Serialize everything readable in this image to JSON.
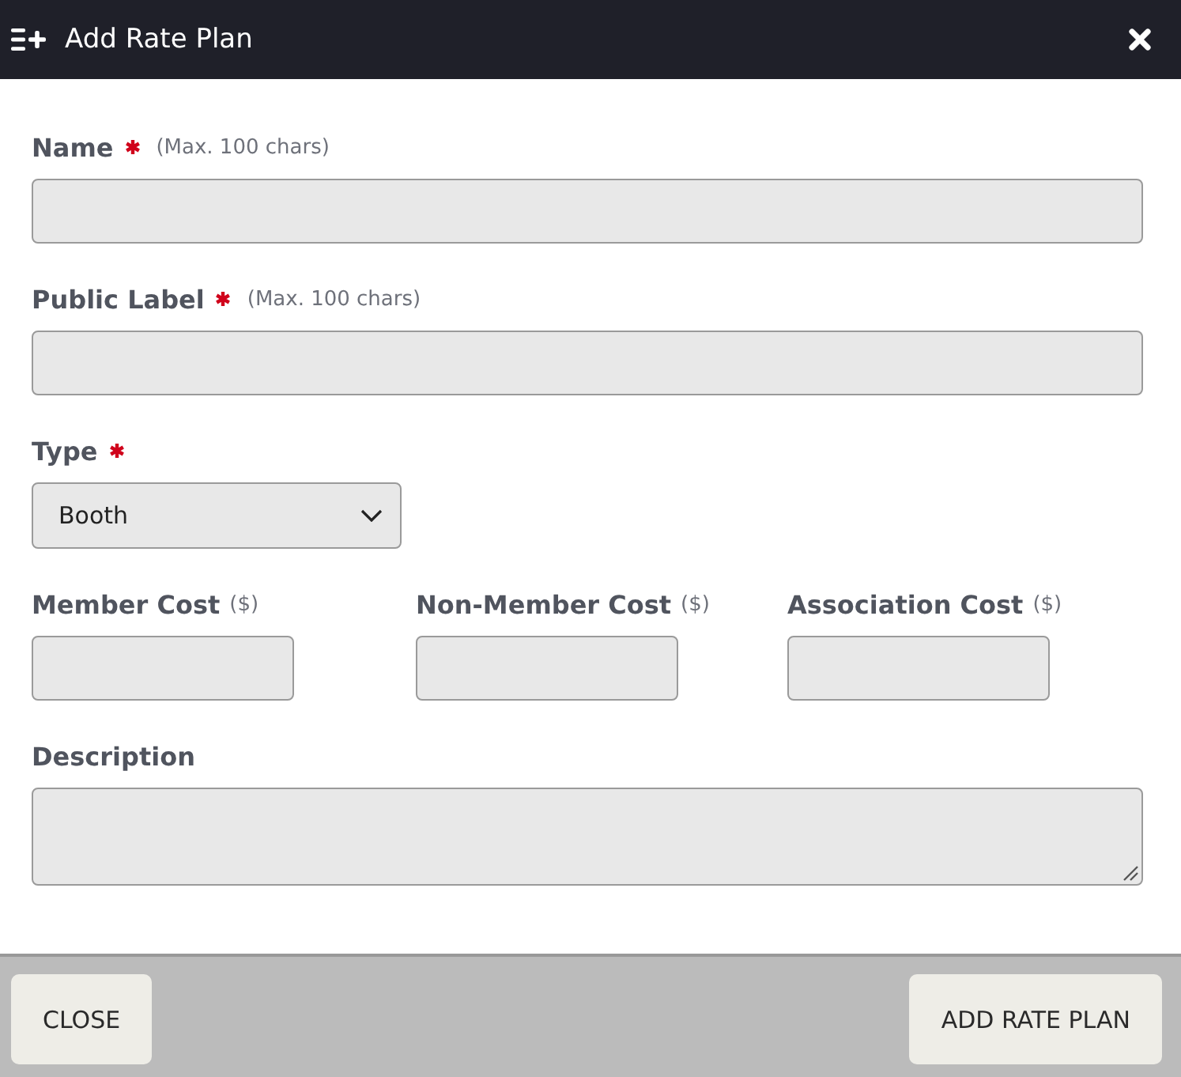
{
  "dialog": {
    "title": "Add Rate Plan"
  },
  "fields": [
    {
      "kind": "text",
      "label": "Name",
      "required": true,
      "hint": "(Max. 100 chars)"
    },
    {
      "kind": "text",
      "label": "Public Label",
      "required": true,
      "hint": "(Max. 100 chars)"
    },
    {
      "kind": "select",
      "label": "Type",
      "required": true,
      "value": "Booth"
    }
  ],
  "cost_fields": [
    {
      "label": "Member Cost",
      "unit": "($)"
    },
    {
      "label": "Non-Member Cost",
      "unit": "($)"
    },
    {
      "label": "Association Cost",
      "unit": "($)"
    }
  ],
  "description": {
    "label": "Description"
  },
  "footer": {
    "buttons": [
      {
        "label": "CLOSE"
      },
      {
        "label": "ADD RATE PLAN"
      }
    ]
  }
}
